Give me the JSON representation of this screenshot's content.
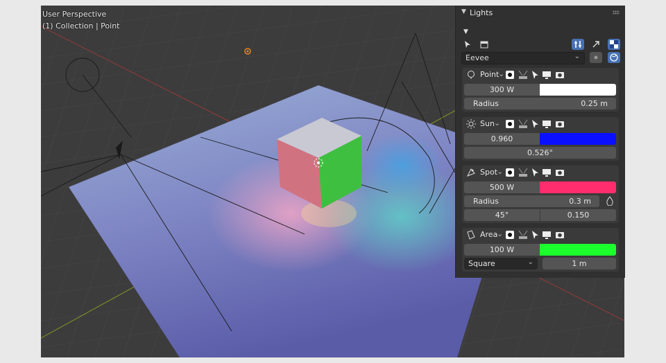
{
  "viewport": {
    "title": "User Perspective",
    "subtitle": "(1) Collection | Point"
  },
  "panel": {
    "title": "Lights",
    "engine": "Eevee",
    "lights": [
      {
        "name": "Point",
        "power": "300 W",
        "color": "#ffffff",
        "radius_label": "Radius",
        "radius_value": "0.25 m"
      },
      {
        "name": "Sun",
        "strength": "0.960",
        "color": "#0a10ff",
        "angle": "0.526°"
      },
      {
        "name": "Spot",
        "power": "500 W",
        "color": "#ff2d6e",
        "radius_label": "Radius",
        "radius_value": "0.3 m",
        "spot_size": "45°",
        "blend": "0.150"
      },
      {
        "name": "Area",
        "power": "100 W",
        "color": "#1bff2c",
        "shape": "Square",
        "size": "1 m"
      }
    ]
  }
}
